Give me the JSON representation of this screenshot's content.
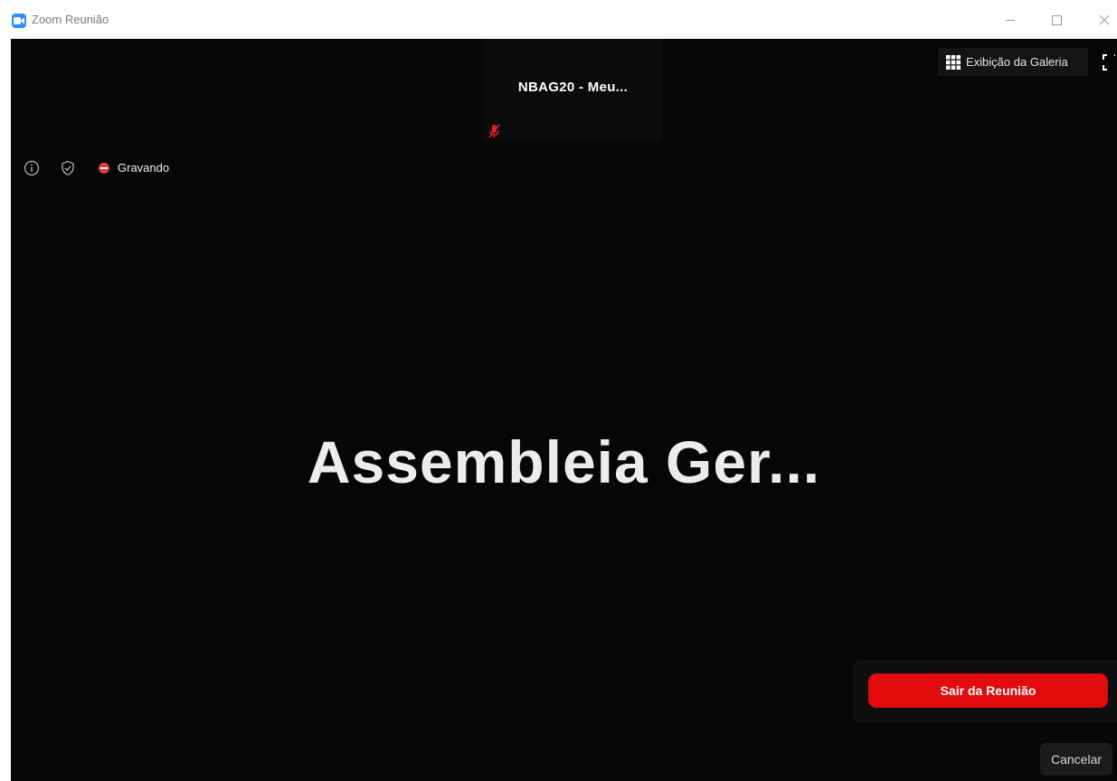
{
  "window": {
    "title": "Zoom Reunião",
    "accent": "#2d8cff",
    "controls": [
      "minimize-icon",
      "maximize-icon",
      "close-icon"
    ]
  },
  "thumbnail": {
    "participant_name": "NBAG20 - Meu...",
    "mic_state": "muted",
    "mic_icon": "mic-muted-icon",
    "mic_color": "#e02020"
  },
  "top_right": {
    "gallery_label": "Exibição da Galeria",
    "gallery_icon": "grid-icon",
    "fullscreen_icon": "fullscreen-icon"
  },
  "status": {
    "icons": [
      "info-icon",
      "shield-check-icon",
      "recording-icon"
    ],
    "recording_label": "Gravando",
    "recording_color": "#e53b3b"
  },
  "main": {
    "title": "Assembleia  Ger..."
  },
  "leave_dialog": {
    "leave_label": "Sair da Reunião",
    "cancel_label": "Cancelar",
    "leave_color": "#e10b0b"
  }
}
